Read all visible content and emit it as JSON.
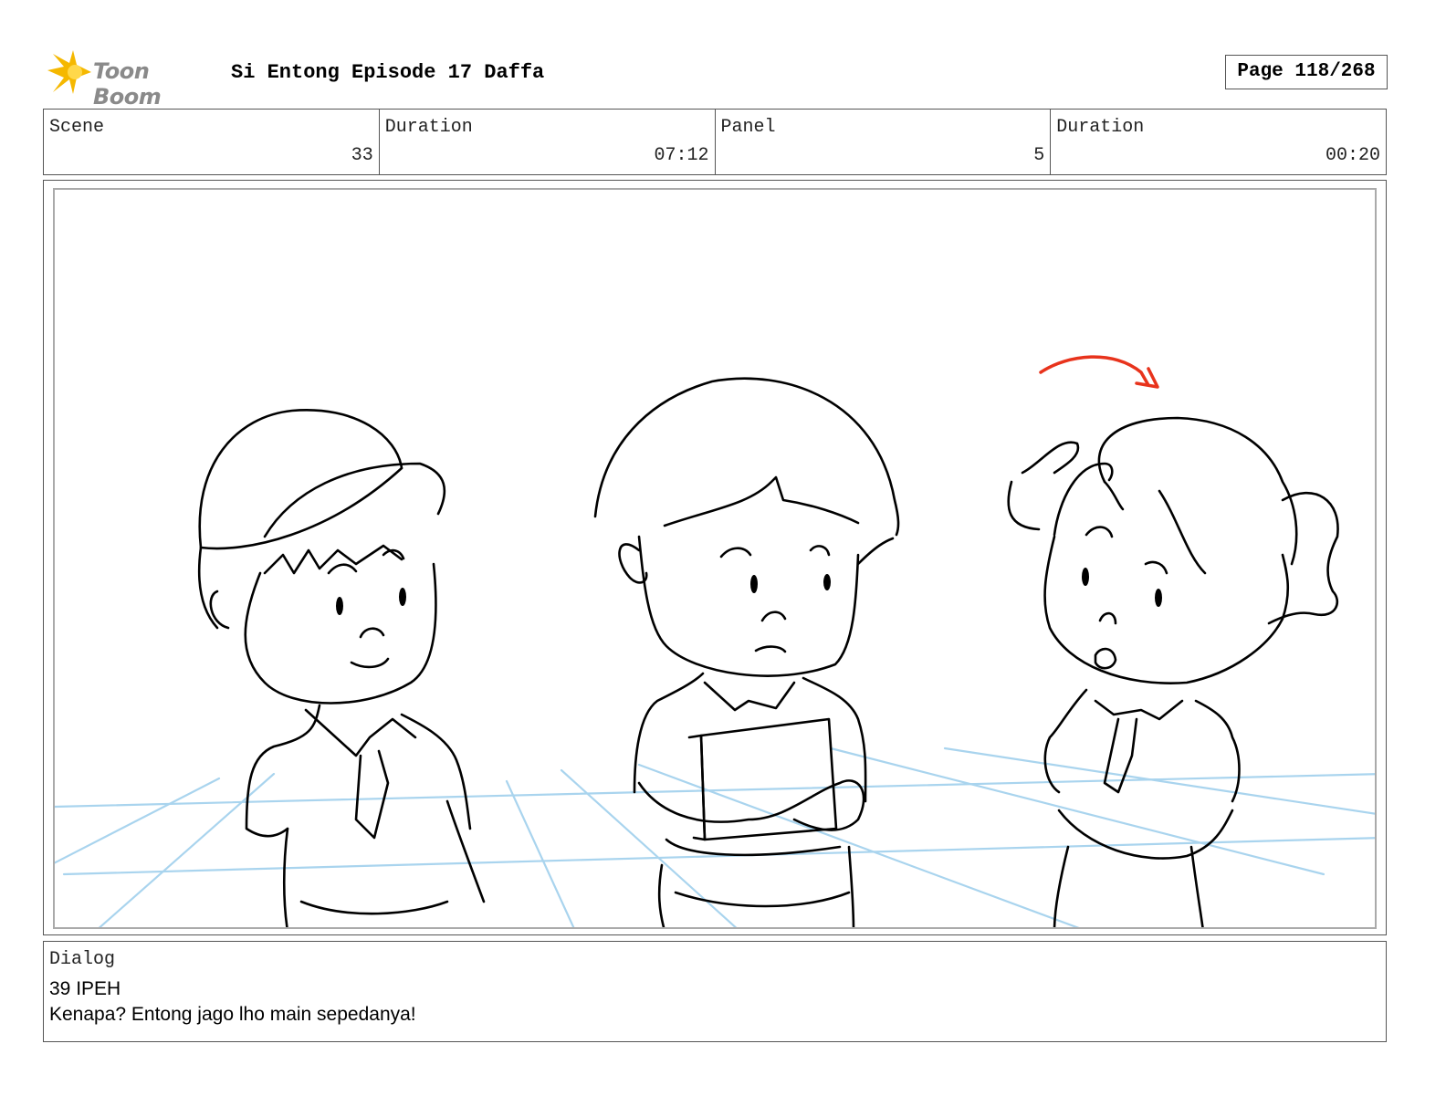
{
  "logo": {
    "text": "Toon Boom",
    "icon": "starburst-logo-icon",
    "color": "#f5b800"
  },
  "title": "Si Entong Episode 17 Daffa",
  "page": "Page 118/268",
  "info": {
    "scene_label": "Scene",
    "scene_value": "33",
    "scene_duration_label": "Duration",
    "scene_duration_value": "07:12",
    "panel_label": "Panel",
    "panel_value": "5",
    "panel_duration_label": "Duration",
    "panel_duration_value": "00:20"
  },
  "panel_art": {
    "description_icon": "storyboard-sketch-three-children",
    "arrow_color": "#e8331c",
    "grid_color": "#a9d4ee"
  },
  "dialog": {
    "label": "Dialog",
    "line1": "39 IPEH",
    "line2": "Kenapa? Entong jago lho main sepedanya!"
  }
}
